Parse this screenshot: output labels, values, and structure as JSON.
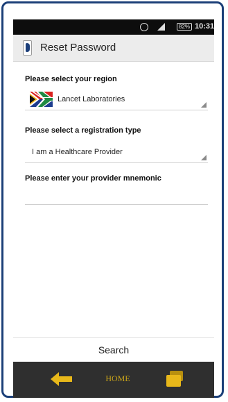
{
  "statusbar": {
    "battery": "82%",
    "time": "10:31",
    "alarm_icon": "alarm-clock-icon",
    "signal_icon": "lte-signal-icon"
  },
  "actionbar": {
    "title": "Reset Password",
    "icon": "app-logo-icon"
  },
  "form": {
    "region_label": "Please select your region",
    "region_value": "Lancet Laboratories",
    "region_flag_icon": "south-africa-flag-icon",
    "registration_label": "Please select a registration type",
    "registration_value": "I am a Healthcare Provider",
    "mnemonic_label": "Please enter your provider mnemonic",
    "mnemonic_value": ""
  },
  "search": {
    "label": "Search"
  },
  "navbar": {
    "back_icon": "back-arrow-icon",
    "home_label": "HOME",
    "recent_icon": "recent-apps-icon",
    "accent_color": "#e8b81a"
  }
}
